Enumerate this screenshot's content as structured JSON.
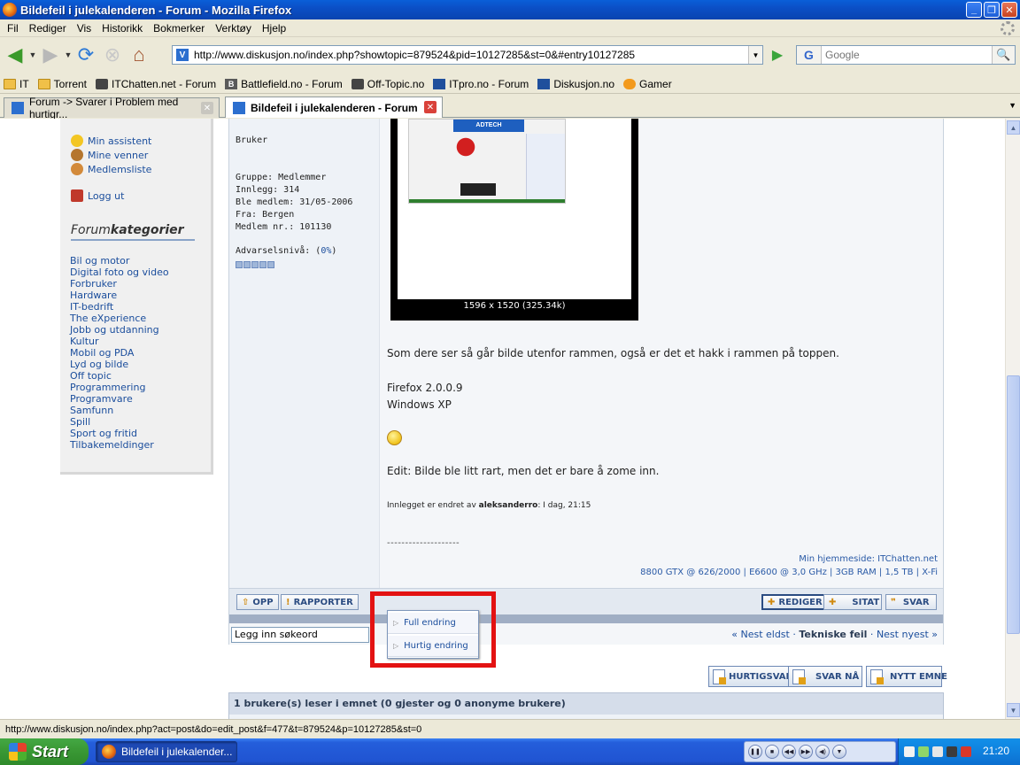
{
  "window": {
    "title": "Bildefeil i julekalenderen - Forum - Mozilla Firefox"
  },
  "menu": [
    "Fil",
    "Rediger",
    "Vis",
    "Historikk",
    "Bokmerker",
    "Verktøy",
    "Hjelp"
  ],
  "url": "http://www.diskusjon.no/index.php?showtopic=879524&pid=10127285&st=0&#entry10127285",
  "search_placeholder": "Google",
  "bookmarks": [
    "IT",
    "Torrent",
    "ITChatten.net - Forum",
    "Battlefield.no - Forum",
    "Off-Topic.no",
    "ITpro.no - Forum",
    "Diskusjon.no",
    "Gamer"
  ],
  "tabs": [
    {
      "label": "Forum -> Svarer i Problem med hurtigr...",
      "active": false
    },
    {
      "label": "Bildefeil i julekalenderen - Forum",
      "active": true
    }
  ],
  "sidebar": {
    "items": [
      "Min assistent",
      "Mine venner",
      "Medlemsliste",
      "Logg ut"
    ],
    "forum_heading_a": "Forum",
    "forum_heading_b": "kategorier",
    "categories": [
      "Bil og motor",
      "Digital foto og video",
      "Forbruker",
      "Hardware",
      "IT-bedrift",
      "The eXperience",
      "Jobb og utdanning",
      "Kultur",
      "Mobil og PDA",
      "Lyd og bilde",
      "Off topic",
      "Programmering",
      "Programvare",
      "Samfunn",
      "Spill",
      "Sport og fritid",
      "Tilbakemeldinger"
    ]
  },
  "user": {
    "role": "Bruker",
    "group": "Gruppe: Medlemmer",
    "posts": "Innlegg: 314",
    "joined": "Ble medlem: 31/05-2006",
    "from": "Fra: Bergen",
    "member_no": "Medlem nr.: 101130",
    "warn_label": "Advarselsnivå: (",
    "warn_value": "0%",
    "warn_close": ")"
  },
  "post": {
    "image_caption": "1596 x 1520 (325.34k)",
    "embedded_banner": "ADTECH",
    "line1": "Som dere ser så går bilde utenfor rammen, også er det et hakk i rammen på toppen.",
    "line2": "Firefox 2.0.0.9",
    "line3": "Windows XP",
    "line4": "Edit: Bilde ble litt rart, men det er bare å zome inn.",
    "edited_prefix": "Innlegget er endret av ",
    "edited_user": "aleksanderro",
    "edited_suffix": ": I dag, 21:15",
    "dashes": "--------------------",
    "sig_home_label": "Min hjemmeside: ",
    "sig_home_link": "ITChatten.net",
    "sig_specs": "8800 GTX @ 626/2000 | E6600 @ 3,0 GHz | 3GB RAM | 1,5 TB | X-Fi"
  },
  "postbar": {
    "opp": "OPP",
    "rapporter": "RAPPORTER",
    "rediger": "REDIGER",
    "sitat": "SITAT",
    "svar": "SVAR"
  },
  "popup": [
    "Full endring",
    "Hurtig endring"
  ],
  "nav": {
    "search_value": "Legg inn søkeord",
    "prev": "« Nest eldst",
    "sep1": " · ",
    "middle": "Tekniske feil",
    "sep2": " · ",
    "next": "Nest nyest »"
  },
  "bottom_buttons": [
    "HURTIGSVAR",
    "SVAR NÅ",
    "NYTT EMNE"
  ],
  "readers": "1 brukere(s) leser i emnet (0 gjester og 0 anonyme brukere)",
  "status": "http://www.diskusjon.no/index.php?act=post&do=edit_post&f=477&t=879524&p=10127285&st=0",
  "taskbar": {
    "start": "Start",
    "item": "Bildefeil i julekalender...",
    "clock": "21:20"
  },
  "colors": {
    "accent_red_box": "#e31212",
    "link_blue": "#1a4d9c",
    "xp_blue": "#245edb"
  }
}
